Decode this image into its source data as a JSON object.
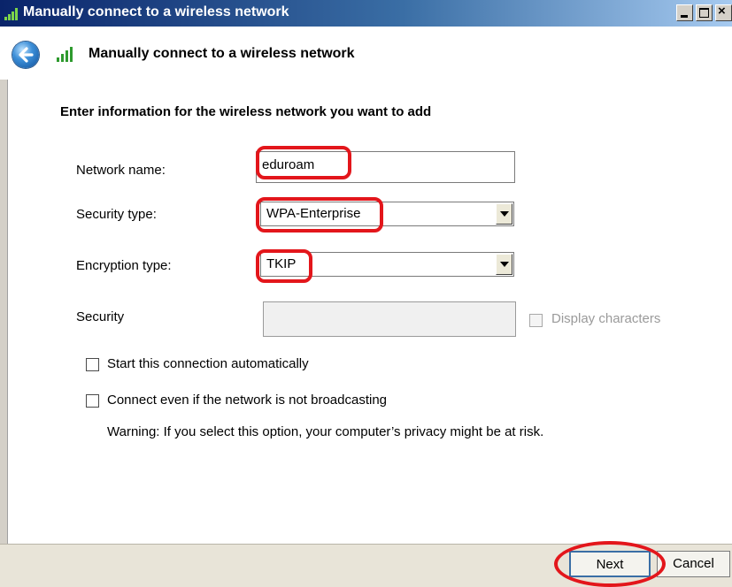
{
  "window": {
    "title": "Manually connect to a wireless network"
  },
  "header": {
    "title": "Manually connect to a wireless network"
  },
  "form": {
    "instructions": "Enter information for the wireless network you want to add",
    "network_name": {
      "label": "Network name:",
      "value": "eduroam"
    },
    "security_type": {
      "label": "Security type:",
      "value": "WPA-Enterprise"
    },
    "encryption_type": {
      "label": "Encryption type:",
      "value": "TKIP"
    },
    "security_key": {
      "label": "Security",
      "value": "",
      "display_characters_label": "Display characters"
    },
    "auto_start": {
      "label": "Start this connection automatically"
    },
    "connect_hidden": {
      "label": "Connect even if the network is not broadcasting"
    },
    "warning": "Warning: If you select this option, your computer’s privacy might be at risk."
  },
  "buttons": {
    "next": "Next",
    "cancel": "Cancel"
  },
  "colors": {
    "highlight": "#e3161b",
    "titlebar_start": "#0a246a",
    "titlebar_end": "#a6caf0",
    "dialog_bg": "#d4d0c8"
  },
  "icons": {
    "title": "wireless-signal-icon",
    "back": "back-arrow-icon",
    "dropdown": "chevron-down-icon"
  }
}
